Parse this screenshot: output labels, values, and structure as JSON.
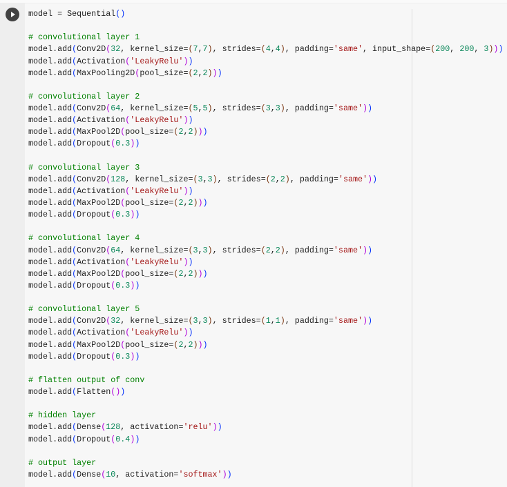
{
  "cell": {
    "run_icon": "play-icon",
    "code_lines": [
      "model = Sequential()",
      "",
      "# convolutional layer 1",
      "model.add(Conv2D(32, kernel_size=(7,7), strides=(4,4), padding='same', input_shape=(200, 200, 3)))",
      "model.add(Activation('LeakyRelu'))",
      "model.add(MaxPooling2D(pool_size=(2,2)))",
      "",
      "# convolutional layer 2",
      "model.add(Conv2D(64, kernel_size=(5,5), strides=(3,3), padding='same'))",
      "model.add(Activation('LeakyRelu'))",
      "model.add(MaxPool2D(pool_size=(2,2)))",
      "model.add(Dropout(0.3))",
      "",
      "# convolutional layer 3",
      "model.add(Conv2D(128, kernel_size=(3,3), strides=(2,2), padding='same'))",
      "model.add(Activation('LeakyRelu'))",
      "model.add(MaxPool2D(pool_size=(2,2)))",
      "model.add(Dropout(0.3))",
      "",
      "# convolutional layer 4",
      "model.add(Conv2D(64, kernel_size=(3,3), strides=(2,2), padding='same'))",
      "model.add(Activation('LeakyRelu'))",
      "model.add(MaxPool2D(pool_size=(2,2)))",
      "model.add(Dropout(0.3))",
      "",
      "# convolutional layer 5",
      "model.add(Conv2D(32, kernel_size=(3,3), strides=(1,1), padding='same'))",
      "model.add(Activation('LeakyRelu'))",
      "model.add(MaxPool2D(pool_size=(2,2)))",
      "model.add(Dropout(0.3))",
      "",
      "# flatten output of conv",
      "model.add(Flatten())",
      "",
      "# hidden layer",
      "model.add(Dense(128, activation='relu'))",
      "model.add(Dropout(0.4))",
      "",
      "# output layer",
      "model.add(Dense(10, activation='softmax'))"
    ]
  },
  "colors": {
    "comment": "#008000",
    "string": "#a31515",
    "number": "#098658",
    "bracket_levels": [
      "#0431fa",
      "#af00db",
      "#7b3814"
    ]
  }
}
